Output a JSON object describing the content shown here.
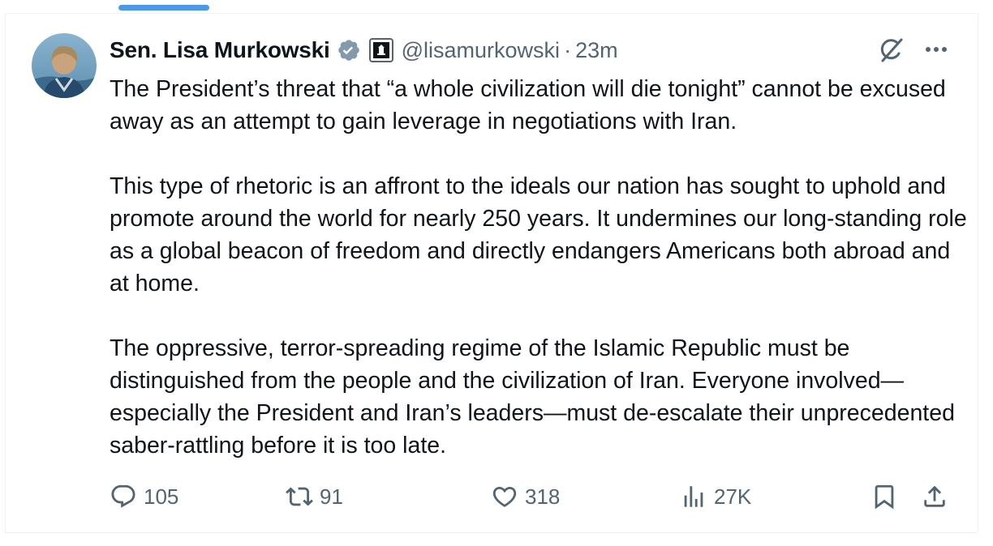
{
  "tweet": {
    "author_name": "Sen. Lisa Murkowski",
    "handle": "@lisamurkowski",
    "separator": "·",
    "time": "23m",
    "paragraphs": [
      "The President’s threat that “a whole civilization will die tonight” cannot be excused away as an attempt to gain leverage in negotiations with Iran.",
      "This type of rhetoric is an affront to the ideals our nation has sought to uphold and promote around the world for nearly 250 years. It undermines our long-standing role as a global beacon of freedom and directly endangers Americans both abroad and at home.",
      "The oppressive, terror-spreading regime of the Islamic Republic must be distinguished from the people and the civilization of Iran. Everyone involved—especially the President and Iran’s leaders—must de-escalate their unprecedented saber-rattling before it is too late."
    ]
  },
  "actions": {
    "replies": "105",
    "reposts": "91",
    "likes": "318",
    "views": "27K"
  },
  "icons": {
    "verified": "verified-badge-icon",
    "affiliation": "government-affiliation-icon",
    "grok": "grok-icon",
    "more": "more-icon",
    "reply": "reply-icon",
    "repost": "repost-icon",
    "like": "like-icon",
    "views": "views-icon",
    "bookmark": "bookmark-icon",
    "share": "share-icon"
  },
  "colors": {
    "verified_badge": "#829aab",
    "text_primary": "#0f1419",
    "text_secondary": "#536471",
    "tab_indicator": "#4a99e9"
  }
}
